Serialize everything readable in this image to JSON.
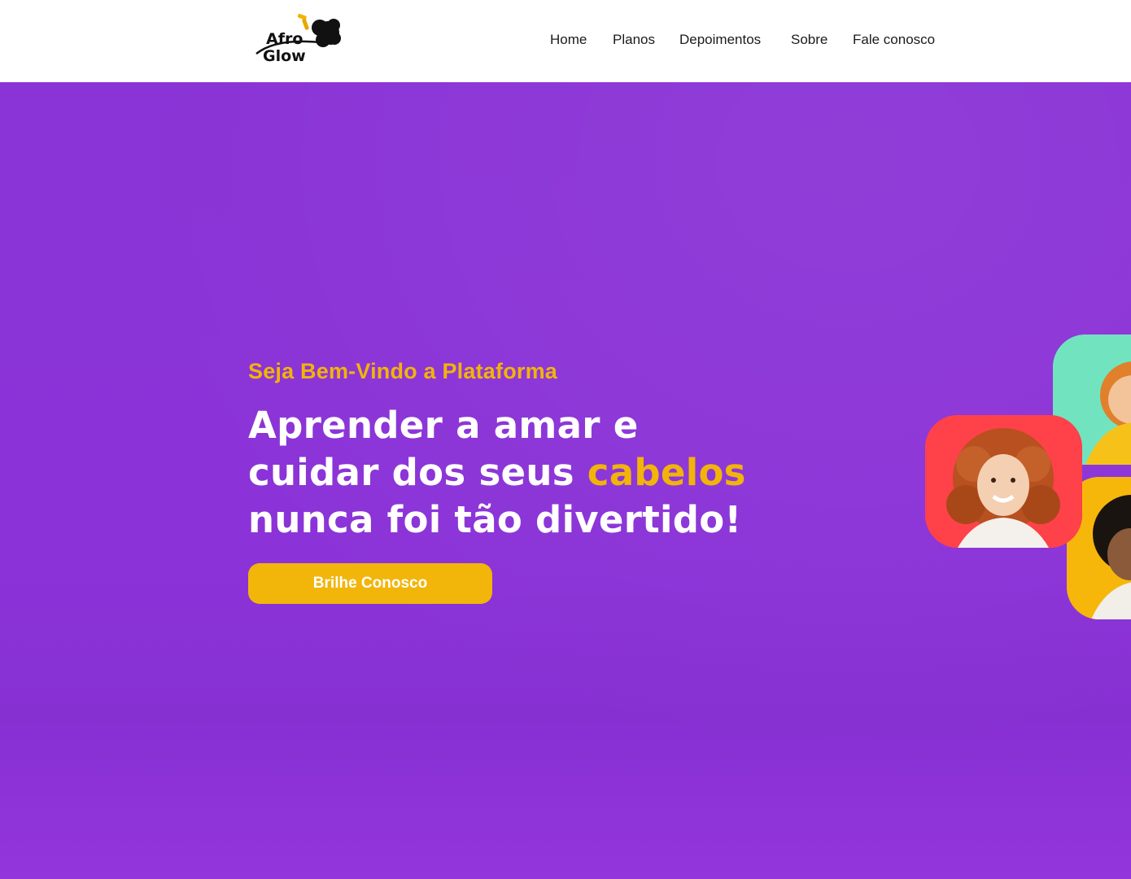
{
  "header": {
    "logo": {
      "line1": "Afro",
      "line2": "Glow"
    },
    "nav": [
      {
        "label": "Home"
      },
      {
        "label": "Planos"
      },
      {
        "label": "Depoimentos"
      },
      {
        "label": "Sobre"
      },
      {
        "label": "Fale conosco"
      }
    ]
  },
  "hero": {
    "eyebrow": "Seja Bem-Vindo a Plataforma",
    "headline": {
      "line1": "Aprender a amar e",
      "line2_start": "cuidar dos seus ",
      "line2_accent": "cabelos",
      "line3": "nunca foi tão divertido!"
    },
    "cta_label": "Brilhe Conosco"
  },
  "colors": {
    "hero_background": "#8a33d6",
    "accent": "#f2b409",
    "button": "#f2b50a",
    "card_teal": "#72e3bf",
    "card_red": "#ff4149",
    "card_yellow": "#f6b70a"
  },
  "icons": [
    "afro-glow-logo",
    "child-photo-curly-red-hair",
    "child-photo-teal-card",
    "child-photo-yellow-card"
  ]
}
